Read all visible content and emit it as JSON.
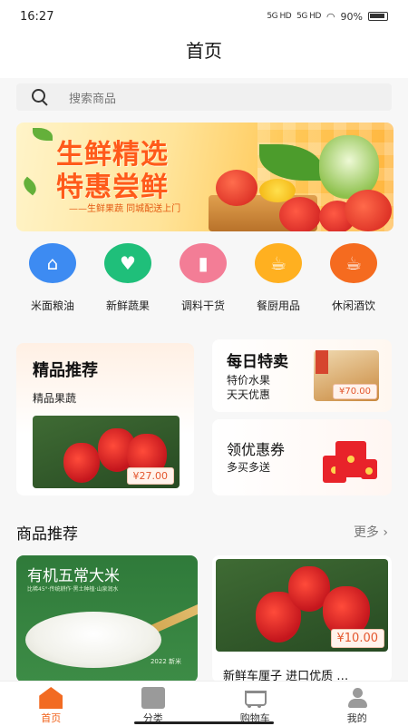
{
  "status": {
    "time": "16:27",
    "signal1": "5G HD",
    "signal2": "5G HD",
    "battery": "90%"
  },
  "header": {
    "title": "首页"
  },
  "search": {
    "placeholder": "搜索商品"
  },
  "banner": {
    "line1": "生鲜精选",
    "line2": "特惠尝鲜",
    "subtitle": "——生鲜果蔬 同城配送上门"
  },
  "categories": [
    {
      "label": "米面粮油",
      "icon": "rice-bag-icon",
      "color": "#3d8bf2"
    },
    {
      "label": "新鲜蔬果",
      "icon": "carrot-icon",
      "color": "#1fbf7a"
    },
    {
      "label": "调料干货",
      "icon": "seasoning-bottle-icon",
      "color": "#f37d96"
    },
    {
      "label": "餐厨用品",
      "icon": "kitchenware-icon",
      "color": "#ffb020"
    },
    {
      "label": "休闲酒饮",
      "icon": "drink-cup-icon",
      "color": "#f56b1f"
    }
  ],
  "featured": {
    "title": "精品推荐",
    "subtitle": "精品果蔬",
    "price": "¥27.00"
  },
  "daily": {
    "title": "每日特卖",
    "line1": "特价水果",
    "line2": "天天优惠",
    "price": "¥70.00"
  },
  "coupon": {
    "title": "领优惠券",
    "subtitle": "多买多送"
  },
  "recommend": {
    "title": "商品推荐",
    "more": "更多",
    "products": [
      {
        "name": "有机五常大米",
        "small_text": "比稀45°·传统耕作·黑土种植·山泉润水",
        "year": "2022 新米"
      },
      {
        "name": "新鲜车厘子 进口优质 …",
        "price": "¥10.00"
      }
    ]
  },
  "tabs": [
    {
      "label": "首页",
      "icon": "home-icon"
    },
    {
      "label": "分类",
      "icon": "category-icon"
    },
    {
      "label": "购物车",
      "icon": "cart-icon"
    },
    {
      "label": "我的",
      "icon": "profile-icon"
    }
  ]
}
